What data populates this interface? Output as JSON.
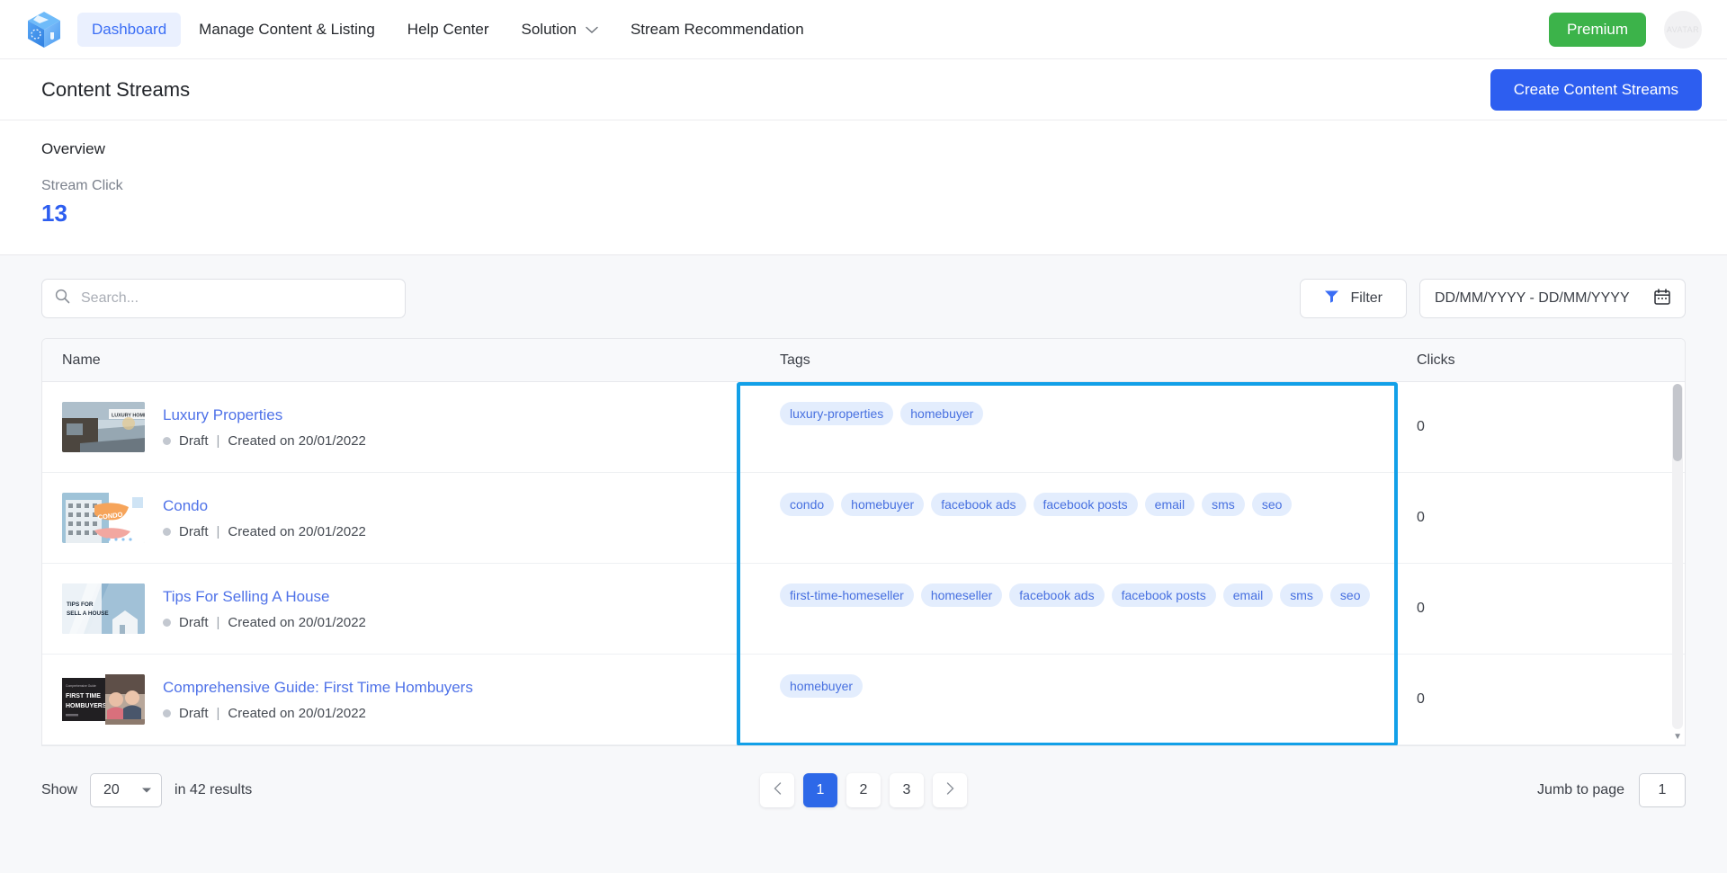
{
  "nav": {
    "logo_icon": "cube-logo-icon",
    "items": [
      {
        "label": "Dashboard",
        "active": true,
        "has_caret": false
      },
      {
        "label": "Manage Content & Listing",
        "active": false,
        "has_caret": false
      },
      {
        "label": "Help Center",
        "active": false,
        "has_caret": false
      },
      {
        "label": "Solution",
        "active": false,
        "has_caret": true
      },
      {
        "label": "Stream Recommendation",
        "active": false,
        "has_caret": false
      }
    ],
    "premium_label": "Premium",
    "avatar_label": "AVATAR"
  },
  "page": {
    "title": "Content Streams",
    "create_button": "Create Content Streams"
  },
  "overview": {
    "title": "Overview",
    "metric_label": "Stream Click",
    "metric_value": "13"
  },
  "toolbar": {
    "search_placeholder": "Search...",
    "search_value": "",
    "search_icon": "search-icon",
    "filter_label": "Filter",
    "filter_icon": "funnel-icon",
    "date_label": "DD/MM/YYYY - DD/MM/YYYY",
    "calendar_icon": "calendar-icon"
  },
  "table": {
    "columns": [
      "Name",
      "Tags",
      "Clicks"
    ],
    "rows": [
      {
        "name": "Luxury Properties",
        "status": "Draft",
        "created": "Created on 20/01/2022",
        "separator": "|",
        "thumb_caption": "LUXURY HOME",
        "tags": [
          "luxury-properties",
          "homebuyer"
        ],
        "clicks": "0"
      },
      {
        "name": "Condo",
        "status": "Draft",
        "created": "Created on 20/01/2022",
        "separator": "|",
        "thumb_caption": "CONDO",
        "tags": [
          "condo",
          "homebuyer",
          "facebook ads",
          "facebook posts",
          "email",
          "sms",
          "seo"
        ],
        "clicks": "0"
      },
      {
        "name": "Tips For Selling A House",
        "status": "Draft",
        "created": "Created on 20/01/2022",
        "separator": "|",
        "thumb_caption": "TIPS FOR SELL A HOUSE",
        "tags": [
          "first-time-homeseller",
          "homeseller",
          "facebook ads",
          "facebook posts",
          "email",
          "sms",
          "seo"
        ],
        "clicks": "0"
      },
      {
        "name": "Comprehensive Guide: First Time Hombuyers",
        "status": "Draft",
        "created": "Created on 20/01/2022",
        "separator": "|",
        "thumb_caption": "FIRST TIME HOMBUYERS",
        "tags": [
          "homebuyer"
        ],
        "clicks": "0"
      }
    ]
  },
  "footer": {
    "show_label": "Show",
    "page_size": "20",
    "results_label": "in 42 results",
    "prev_icon": "chevron-left-icon",
    "next_icon": "chevron-right-icon",
    "pages": [
      "1",
      "2",
      "3"
    ],
    "active_page": "1",
    "jump_label": "Jumb to page",
    "jump_value": "1"
  },
  "colors": {
    "accent_blue": "#2d5ef0",
    "link_blue": "#4f72e8",
    "premium_green": "#3cb34a",
    "tag_bg": "#e3edfd",
    "highlight": "#12a0e8"
  }
}
